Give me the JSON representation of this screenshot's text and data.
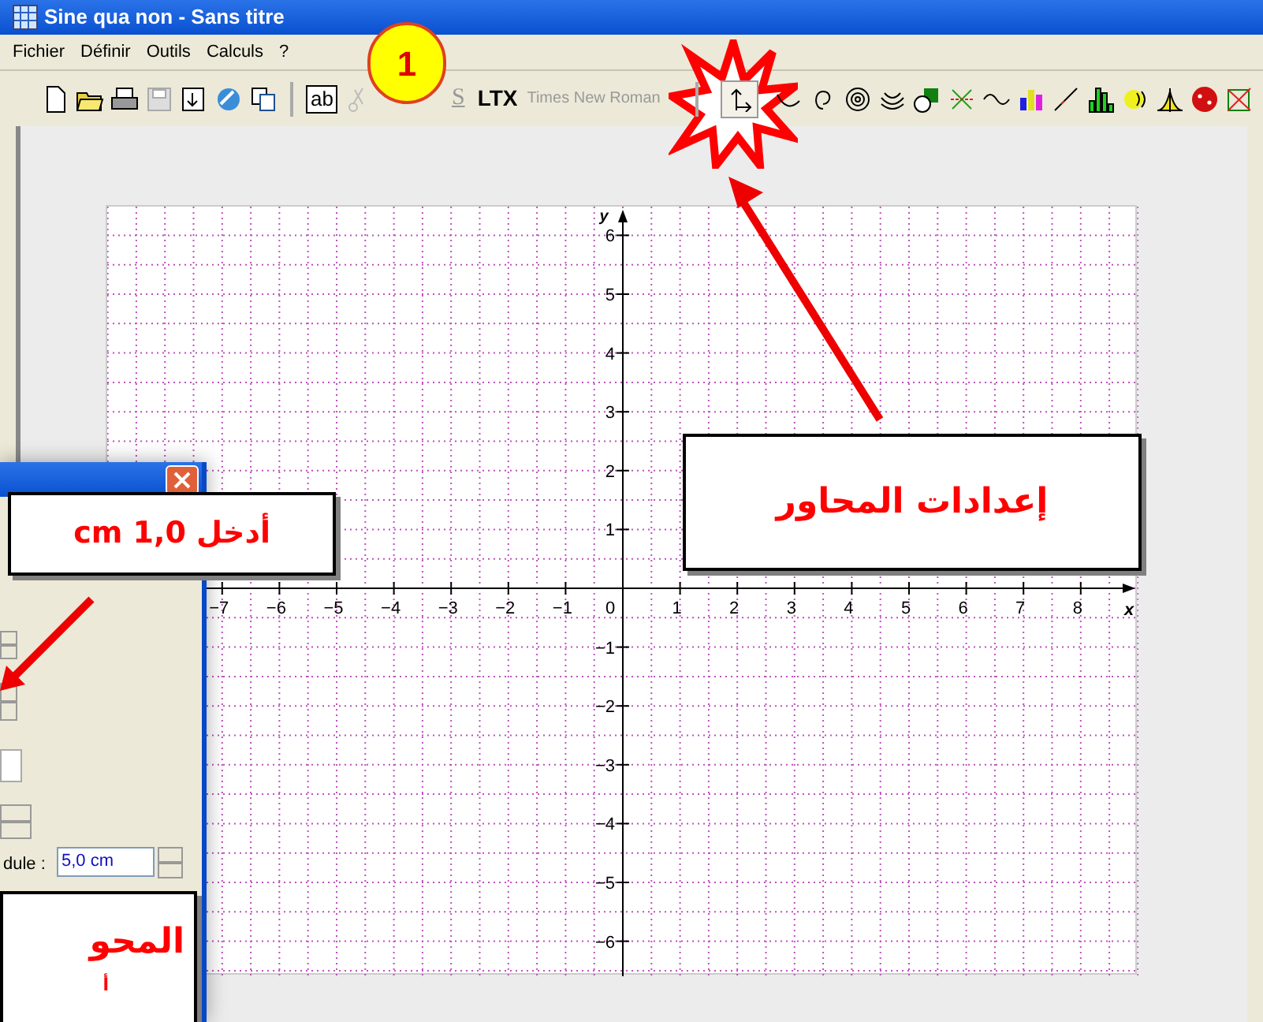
{
  "window": {
    "title": "Sine qua non - Sans titre"
  },
  "menu": [
    "Fichier",
    "Définir",
    "Outils",
    "Calculs",
    "?"
  ],
  "toolbar": {
    "text_tool": "ab",
    "strike": "S",
    "latex": "LTX",
    "font": "Times New Roman"
  },
  "graph": {
    "x_label": "x",
    "y_label": "y",
    "origin": "0",
    "x_ticks": [
      "−7",
      "−6",
      "−5",
      "−4",
      "−3",
      "−2",
      "−1",
      "1",
      "2",
      "3",
      "4",
      "5",
      "6",
      "7",
      "8"
    ],
    "y_ticks": [
      "6",
      "5",
      "4",
      "3",
      "2",
      "1",
      "−1",
      "−2",
      "−3",
      "−4",
      "−5",
      "−6"
    ]
  },
  "dialog": {
    "field_label": "dule :",
    "field_value": "5,0 cm"
  },
  "annotations": {
    "badge": "1",
    "axis_callout": "إعدادات المحاور",
    "enter_callout": "أدخل 1,0 cm",
    "bottom_callout": [
      "المحو",
      "أ"
    ]
  }
}
